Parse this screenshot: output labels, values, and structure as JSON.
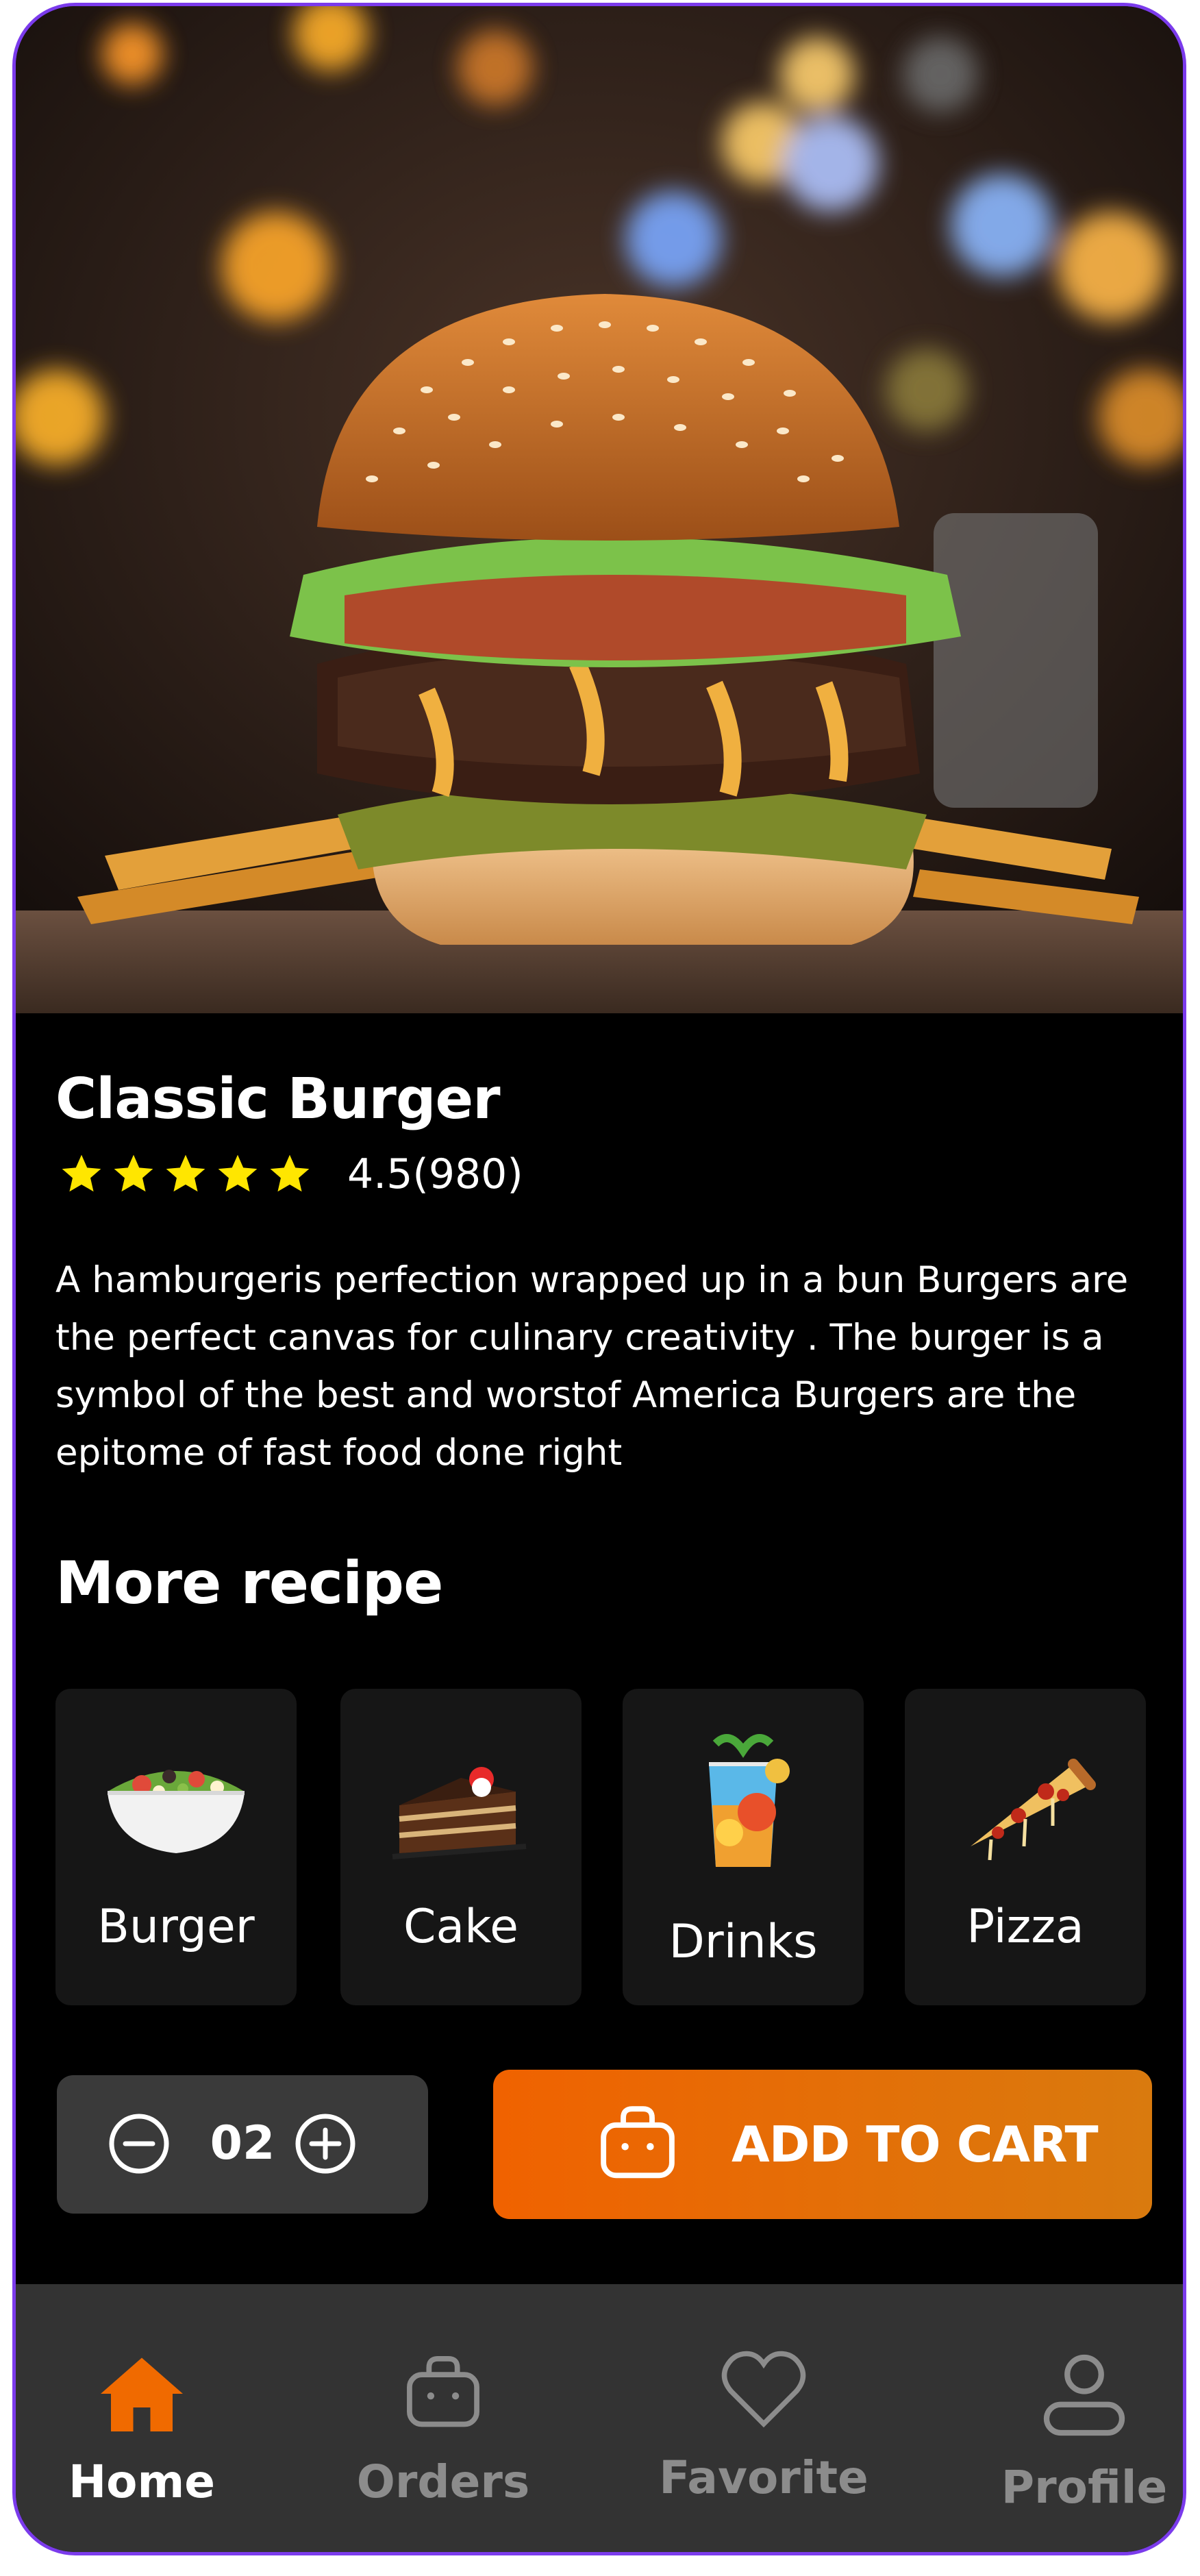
{
  "product": {
    "title": "Classic Burger",
    "rating_text": "4.5(980)",
    "stars": 5,
    "description": "A hamburgeris perfection wrapped up in a bun Burgers are the perfect canvas for culinary creativity . The burger is a symbol of the best and worstof America Burgers are the epitome of fast food done right"
  },
  "more_recipe": {
    "title": "More recipe",
    "items": [
      {
        "label": "Burger",
        "icon": "salad-bowl"
      },
      {
        "label": "Cake",
        "icon": "cake-slice"
      },
      {
        "label": "Drinks",
        "icon": "cocktail"
      },
      {
        "label": "Pizza",
        "icon": "pizza-slice"
      }
    ]
  },
  "cart": {
    "quantity": "02",
    "add_label": "ADD TO CART"
  },
  "nav": {
    "items": [
      {
        "label": "Home",
        "icon": "home-icon",
        "active": true
      },
      {
        "label": "Orders",
        "icon": "bag-icon",
        "active": false
      },
      {
        "label": "Favorite",
        "icon": "heart-icon",
        "active": false
      },
      {
        "label": "Profile",
        "icon": "user-icon",
        "active": false
      }
    ]
  },
  "colors": {
    "accent": "#f06200",
    "accent_end": "#d97a0e",
    "frame": "#7b3bec",
    "star": "#ffe600",
    "nav_bg": "#333333",
    "nav_inactive": "#8c8c8c"
  }
}
